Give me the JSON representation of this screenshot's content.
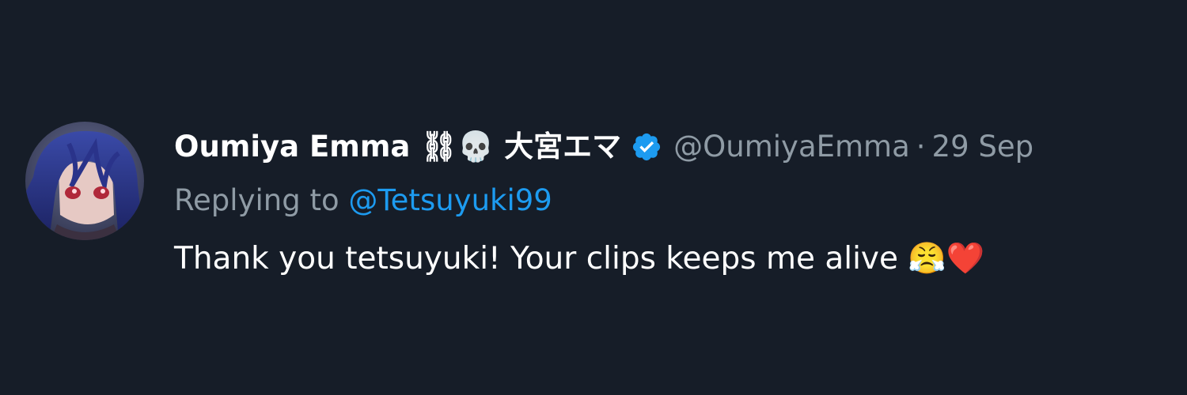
{
  "tweet": {
    "display_name": "Oumiya Emma ⛓💀 大宮エマ",
    "handle": "@OumiyaEmma",
    "separator": "·",
    "date": "29 Sep",
    "replying_label": "Replying to ",
    "replying_to": "@Tetsuyuki99",
    "text": "Thank you tetsuyuki! Your clips keeps me alive 😤❤️",
    "verified_icon": "verified-badge-icon",
    "avatar": "user-avatar-image"
  },
  "colors": {
    "background": "#161d28",
    "name": "#ffffff",
    "secondary": "#8f9ba5",
    "link": "#1d9bf0",
    "verified": "#1d9bf0"
  }
}
